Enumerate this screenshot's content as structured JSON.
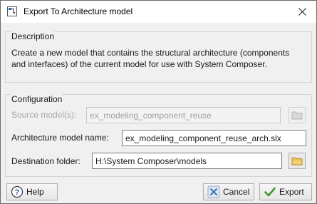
{
  "window": {
    "title": "Export To Architecture model"
  },
  "description": {
    "group_title": "Description",
    "text": "Create a new model that contains the structural architecture (components and interfaces) of the current model for use with System Composer."
  },
  "configuration": {
    "group_title": "Configuration",
    "source_label": "Source model(s):",
    "source_value": "ex_modeling_component_reuse",
    "arch_label": "Architecture model name:",
    "arch_value": "ex_modeling_component_reuse_arch.slx",
    "dest_label": "Destination folder:",
    "dest_value": "H:\\System Composer\\models"
  },
  "buttons": {
    "help": "Help",
    "cancel": "Cancel",
    "export": "Export"
  },
  "icons": {
    "app": "simulink-model-icon",
    "close": "close-icon",
    "browse": "folder-icon",
    "help": "help-icon",
    "cancel": "cancel-x-icon",
    "export": "checkmark-icon"
  }
}
